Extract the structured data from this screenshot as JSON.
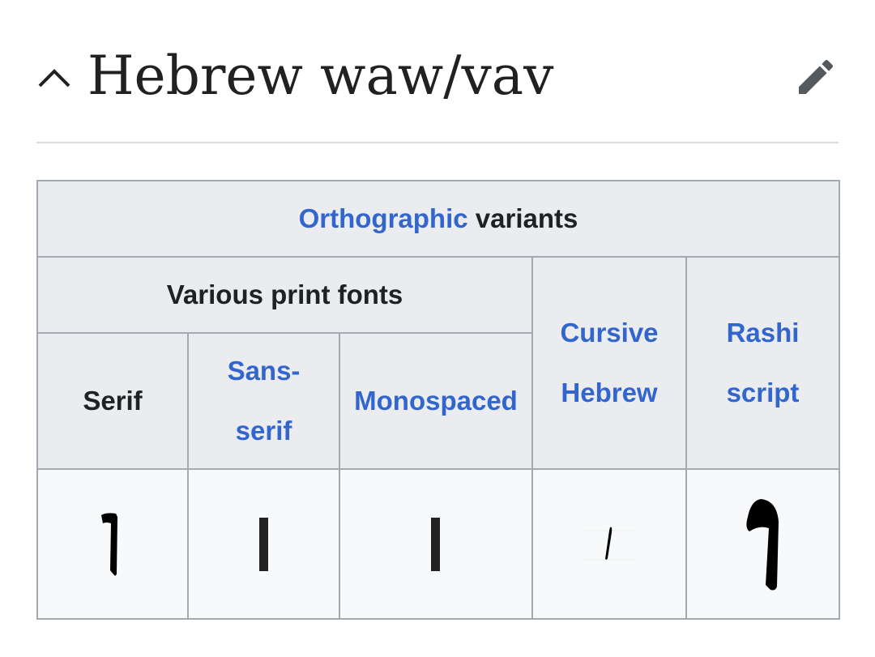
{
  "section": {
    "title": "Hebrew waw/vav",
    "collapse_icon": "chevron-up-icon",
    "edit_icon": "pencil-icon"
  },
  "table": {
    "caption_link": "Orthographic",
    "caption_rest": "variants",
    "group_header": "Various print fonts",
    "columns": {
      "serif": "Serif",
      "sans_serif_1": "Sans-",
      "sans_serif_2": "serif",
      "monospaced": "Monospaced",
      "cursive_1": "Cursive",
      "cursive_2": "Hebrew",
      "rashi_1": "Rashi",
      "rashi_2": "script"
    },
    "glyphs": [
      "serif-vav-glyph",
      "sans-serif-vav-glyph",
      "monospaced-vav-glyph",
      "cursive-vav-glyph",
      "rashi-vav-glyph"
    ]
  },
  "colors": {
    "link": "#3366cc",
    "header_bg": "#eaecf0",
    "border": "#a2a9b1",
    "text": "#202122"
  }
}
